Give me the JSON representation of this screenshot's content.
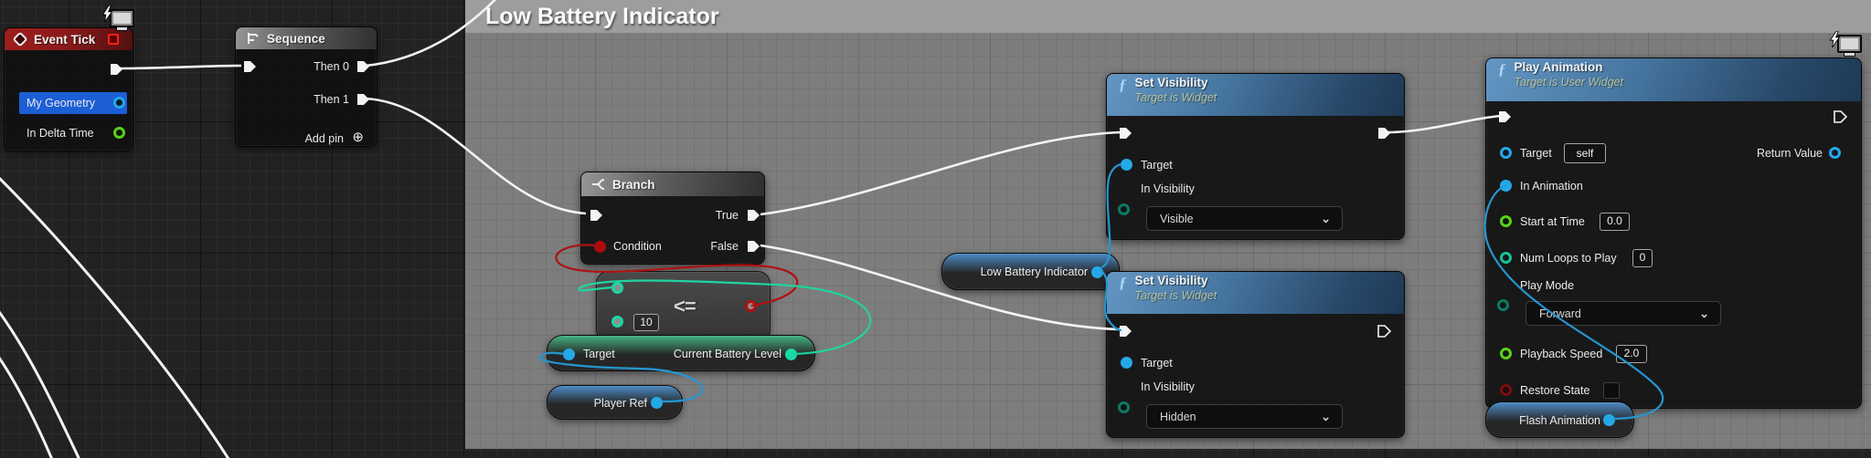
{
  "comment": {
    "title": "Low Battery Indicator"
  },
  "ui": {
    "fn_icon": "ƒ",
    "add_pin_icon": "⊕",
    "chevron": "⌄"
  },
  "colors": {
    "event_header": "#8c1a1a",
    "function_header": "#45759f",
    "exec_wire": "#f3f3f3",
    "pin_object": "#25a8e8",
    "pin_int": "#19d8a5",
    "pin_float": "#59d216",
    "pin_bool": "#b40f0f",
    "comment_body": "#7d7d7d"
  },
  "nodes": {
    "event_tick": {
      "title": "Event Tick",
      "pins": {
        "my_geometry": "My Geometry",
        "in_delta_time": "In Delta Time"
      }
    },
    "sequence": {
      "title": "Sequence",
      "pins": {
        "then0": "Then 0",
        "then1": "Then 1"
      },
      "add_pin": "Add pin"
    },
    "branch": {
      "title": "Branch",
      "pins": {
        "condition": "Condition",
        "true": "True",
        "false": "False"
      }
    },
    "compare": {
      "operator": "<=",
      "value": "10"
    },
    "get_current_battery_level": {
      "target": "Target",
      "output": "Current Battery Level"
    },
    "player_ref": {
      "label": "Player Ref"
    },
    "low_battery_indicator": {
      "label": "Low Battery Indicator"
    },
    "set_visibility_visible": {
      "title": "Set Visibility",
      "subtitle": "Target is Widget",
      "pins": {
        "target": "Target",
        "in_visibility": "In Visibility"
      },
      "in_visibility_value": "Visible"
    },
    "set_visibility_hidden": {
      "title": "Set Visibility",
      "subtitle": "Target is Widget",
      "pins": {
        "target": "Target",
        "in_visibility": "In Visibility"
      },
      "in_visibility_value": "Hidden"
    },
    "play_animation": {
      "title": "Play Animation",
      "subtitle": "Target is User Widget",
      "pins": {
        "target": "Target",
        "return_value": "Return Value",
        "in_animation": "In Animation",
        "start_at_time": "Start at Time",
        "num_loops": "Num Loops to Play",
        "play_mode": "Play Mode",
        "playback_speed": "Playback Speed",
        "restore_state": "Restore State"
      },
      "target_value": "self",
      "start_at_time_value": "0.0",
      "num_loops_value": "0",
      "play_mode_value": "Forward",
      "playback_speed_value": "2.0"
    },
    "flash_animation": {
      "label": "Flash Animation"
    }
  }
}
